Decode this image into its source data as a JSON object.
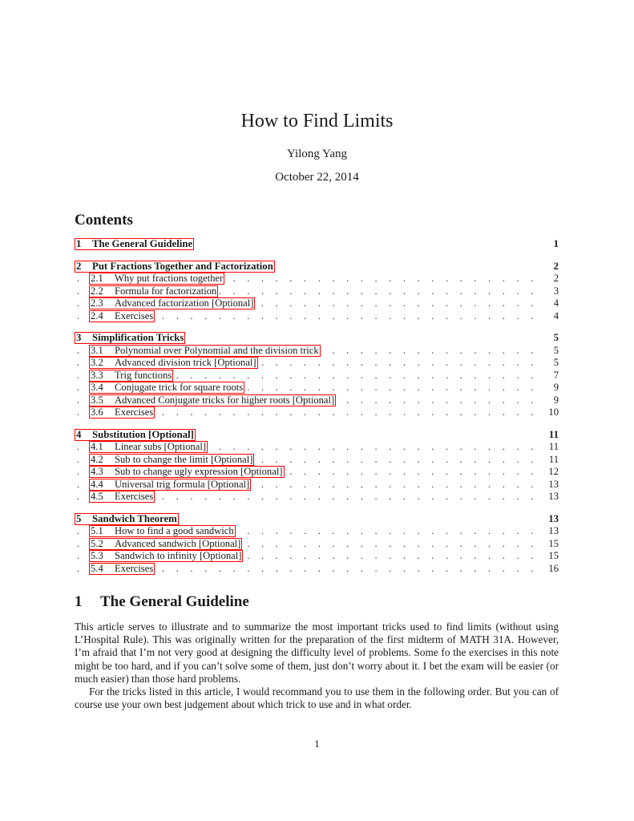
{
  "title": "How to Find Limits",
  "author": "Yilong Yang",
  "date": "October 22, 2014",
  "contents_heading": "Contents",
  "toc": [
    {
      "num": "1",
      "label": "The General Guideline",
      "page": "1",
      "subs": []
    },
    {
      "num": "2",
      "label": "Put Fractions Together and Factorization",
      "page": "2",
      "subs": [
        {
          "num": "2.1",
          "label": "Why put fractions together",
          "page": "2"
        },
        {
          "num": "2.2",
          "label": "Formula for factorization",
          "page": "3"
        },
        {
          "num": "2.3",
          "label": "Advanced factorization [Optional]",
          "page": "4"
        },
        {
          "num": "2.4",
          "label": "Exercises",
          "page": "4"
        }
      ]
    },
    {
      "num": "3",
      "label": "Simplification Tricks",
      "page": "5",
      "subs": [
        {
          "num": "3.1",
          "label": "Polynomial over Polynomial and the division trick",
          "page": "5"
        },
        {
          "num": "3.2",
          "label": "Advanced division trick [Optional]",
          "page": "5"
        },
        {
          "num": "3.3",
          "label": "Trig functions",
          "page": "7"
        },
        {
          "num": "3.4",
          "label": "Conjugate trick for square roots",
          "page": "9"
        },
        {
          "num": "3.5",
          "label": "Advanced Conjugate tricks for higher roots [Optional]",
          "page": "9"
        },
        {
          "num": "3.6",
          "label": "Exercises",
          "page": "10"
        }
      ]
    },
    {
      "num": "4",
      "label": "Substitution [Optional]",
      "page": "11",
      "subs": [
        {
          "num": "4.1",
          "label": "Linear subs [Optional]",
          "page": "11"
        },
        {
          "num": "4.2",
          "label": "Sub to change the limit [Optional]",
          "page": "11"
        },
        {
          "num": "4.3",
          "label": "Sub to change ugly expression [Optional]",
          "page": "12"
        },
        {
          "num": "4.4",
          "label": "Universal trig formula [Optional]",
          "page": "13"
        },
        {
          "num": "4.5",
          "label": "Exercises",
          "page": "13"
        }
      ]
    },
    {
      "num": "5",
      "label": "Sandwich Theorem",
      "page": "13",
      "subs": [
        {
          "num": "5.1",
          "label": "How to find a good sandwich",
          "page": "13"
        },
        {
          "num": "5.2",
          "label": "Advanced sandwich [Optional]",
          "page": "15"
        },
        {
          "num": "5.3",
          "label": "Sandwich to infinity [Optional]",
          "page": "15"
        },
        {
          "num": "5.4",
          "label": "Exercises",
          "page": "16"
        }
      ]
    }
  ],
  "section": {
    "num": "1",
    "title": "The General Guideline",
    "paragraphs": [
      "This article serves to illustrate and to summarize the most important tricks used to find limits (without using L’Hospital Rule). This was originally written for the preparation of the first midterm of MATH 31A. However, I’m afraid that I’m not very good at designing the difficulty level of problems. Some fo the exercises in this note might be too hard, and if you can’t solve some of them, just don’t worry about it. I bet the exam will be easier (or much easier) than those hard problems.",
      "For the tricks listed in this article, I would recommand you to use them in the following order. But you can of course use your own best judgement about which trick to use and in what order."
    ]
  },
  "page_number": "1",
  "colors": {
    "link_border": "#ff0000",
    "text": "#1a1a1a"
  }
}
